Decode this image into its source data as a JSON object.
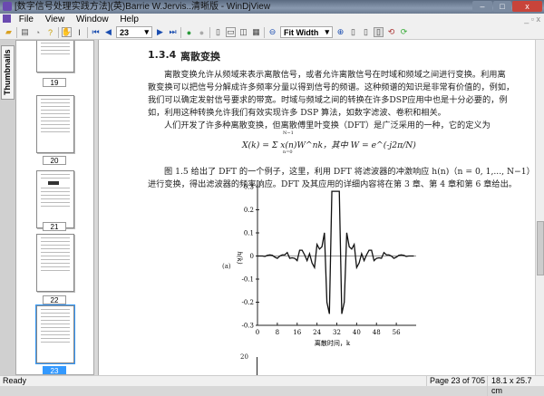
{
  "window": {
    "title": "[数字信号处理实践方法](英)Barrie W.Jervis..清晰版 - WinDjView",
    "min": "–",
    "max": "□",
    "close": "x"
  },
  "menu": [
    "File",
    "View",
    "Window",
    "Help"
  ],
  "toolbar": {
    "page": "23",
    "zoom": "Fit Width"
  },
  "sidebar": {
    "tab": "Thumbnails",
    "pages": [
      "19",
      "20",
      "21",
      "22",
      "23"
    ],
    "selected": "23"
  },
  "document": {
    "heading_num": "1.3.4",
    "heading": "离散变换",
    "p1": [
      "离散变换允许从频域来表示离散信号，或者允许离散信号在时域和频域之间进行变换。利用离",
      "散变换可以把信号分解成许多频率分量以得到信号的频谱。这种频谱的知识是非常有价值的，例如，",
      "我们可以确定发射信号要求的带宽。时域与频域之间的转换在许多DSP应用中也是十分必要的，例",
      "如，利用这种转换允许我们有效实现许多 DSP 算法，如数字滤波、卷积和相关。"
    ],
    "p2": "人们开发了许多种离散变换，但离散傅里叶变换（DFT）是广泛采用的一种，它的定义为",
    "formula": "X(k) = Σ x(n)W^nk，其中 W = e^(-j2π/N)",
    "formula_upper": "N−1",
    "formula_lower": "n=0",
    "p3": [
      "图 1.5 给出了 DFT 的一个例子，这里，利用 DFT 将滤波器的冲激响应 h(n)（n = 0, 1,..., N−1）",
      "进行变换，得出滤波器的频率响应。DFT 及其应用的详细内容将在第 3 章、第 4 章和第 6 章给出。"
    ],
    "panel_label": "(a)",
    "next_chart_tick": "20"
  },
  "chart_data": {
    "type": "line",
    "title": "",
    "xlabel": "离散时间，k",
    "ylabel": "h(k)",
    "xlim": [
      0,
      64
    ],
    "ylim": [
      -0.3,
      0.3
    ],
    "xticks": [
      "0",
      "8",
      "16",
      "24",
      "32",
      "40",
      "48",
      "56"
    ],
    "yticks": [
      "0.3",
      "0.2",
      "0.1",
      "0",
      "-0.1",
      "-0.2",
      "-0.3"
    ],
    "x": [
      0,
      1,
      2,
      3,
      4,
      5,
      6,
      7,
      8,
      9,
      10,
      11,
      12,
      13,
      14,
      15,
      16,
      17,
      18,
      19,
      20,
      21,
      22,
      23,
      24,
      25,
      26,
      27,
      28,
      29,
      30,
      31,
      32,
      33,
      34,
      35,
      36,
      37,
      38,
      39,
      40,
      41,
      42,
      43,
      44,
      45,
      46,
      47,
      48,
      49,
      50,
      51,
      52,
      53,
      54,
      55,
      56,
      57,
      58,
      59,
      60,
      61,
      62,
      63
    ],
    "y": [
      0,
      0,
      0,
      -0.002,
      0.003,
      0.005,
      0.003,
      -0.005,
      -0.01,
      0,
      0.005,
      0.005,
      0.015,
      -0.01,
      -0.008,
      -0.01,
      -0.02,
      0.025,
      0.025,
      0.005,
      -0.02,
      0.01,
      -0.03,
      -0.05,
      0.05,
      0.03,
      0.04,
      0.1,
      -0.2,
      -0.25,
      0.28,
      0.28,
      0.28,
      0.28,
      -0.25,
      -0.2,
      0.1,
      0.04,
      0.03,
      0.05,
      -0.05,
      -0.03,
      0.01,
      -0.02,
      0.005,
      0.025,
      0.025,
      -0.02,
      -0.01,
      -0.008,
      -0.01,
      0.015,
      0.005,
      0.005,
      0,
      -0.01,
      -0.005,
      0.003,
      0.005,
      0.003,
      -0.002,
      0,
      0,
      0
    ]
  },
  "status": {
    "left": "Ready",
    "page": "Page 23 of 705",
    "size": "18.1 x 25.7 cm"
  }
}
